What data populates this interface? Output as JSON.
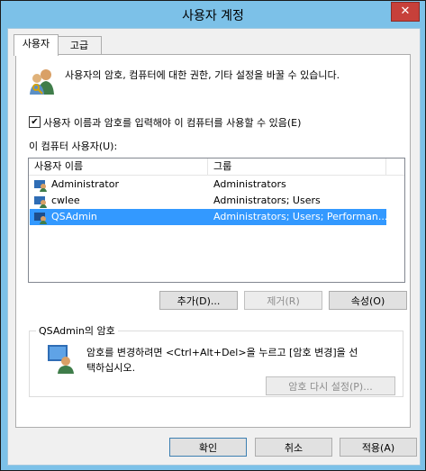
{
  "window": {
    "title": "사용자 계정",
    "close_glyph": "✕"
  },
  "tabs": [
    {
      "label": "사용자"
    },
    {
      "label": "고급"
    }
  ],
  "intro": {
    "text": "사용자의 암호, 컴퓨터에 대한 권한, 기타 설정을 바꿀 수 있습니다."
  },
  "require_login": {
    "checked": true,
    "label": "사용자 이름과 암호를 입력해야 이 컴퓨터를 사용할 수 있음(E)"
  },
  "users_label": "이 컴퓨터 사용자(U):",
  "users_table": {
    "columns": [
      "사용자 이름",
      "그룹"
    ],
    "rows": [
      {
        "name": "Administrator",
        "groups": "Administrators"
      },
      {
        "name": "cwlee",
        "groups": "Administrators; Users"
      },
      {
        "name": "QSAdmin",
        "groups": "Administrators; Users; Performan..."
      }
    ],
    "selected_index": 2
  },
  "list_buttons": {
    "add": "추가(D)...",
    "remove": "제거(R)",
    "properties": "속성(O)"
  },
  "password_group": {
    "title": "QSAdmin의 암호",
    "description_line1": "암호를 변경하려면 <Ctrl+Alt+Del>을 누르고 [암호 변경]을 선",
    "description_line2": "택하십시오.",
    "reset_button": "암호 다시 설정(P)..."
  },
  "dialog_buttons": {
    "ok": "확인",
    "cancel": "취소",
    "apply": "적용(A)"
  },
  "colors": {
    "frame": "#7cc1e8",
    "selection": "#3399ff",
    "close": "#c7403a"
  }
}
